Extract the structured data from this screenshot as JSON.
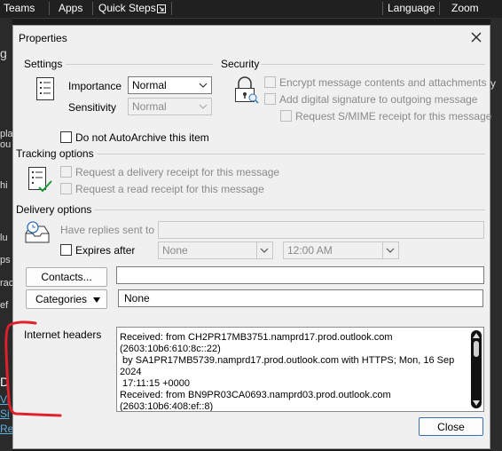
{
  "ribbon": {
    "items": [
      "Teams",
      "Apps",
      "Quick Steps",
      "Language",
      "Zoom"
    ]
  },
  "dialog": {
    "title": "Properties",
    "settings": {
      "group_label": "Settings",
      "importance_label": "Importance",
      "importance_value": "Normal",
      "sensitivity_label": "Sensitivity",
      "sensitivity_value": "Normal",
      "autoarchive_label": "Do not AutoArchive this item"
    },
    "security": {
      "group_label": "Security",
      "encrypt_label": "Encrypt message contents and attachments",
      "signature_label": "Add digital signature to outgoing message",
      "smime_label": "Request S/MIME receipt for this message"
    },
    "tracking": {
      "group_label": "Tracking options",
      "delivery_receipt_label": "Request a delivery receipt for this message",
      "read_receipt_label": "Request a read receipt for this message"
    },
    "delivery": {
      "group_label": "Delivery options",
      "replies_label": "Have replies sent to",
      "replies_value": "",
      "expires_label": "Expires after",
      "expires_date": "None",
      "expires_time": "12:00 AM"
    },
    "contacts_button": "Contacts...",
    "contacts_value": "",
    "categories_button": "Categories",
    "categories_value": "None",
    "headers": {
      "label": "Internet headers",
      "lines": [
        "Received: from CH2PR17MB3751.namprd17.prod.outlook.com",
        "(2603:10b6:610:8c::22)",
        " by SA1PR17MB5739.namprd17.prod.outlook.com with HTTPS; Mon, 16 Sep",
        "2024",
        " 17:11:15 +0000",
        "Received: from BN9PR03CA0693.namprd03.prod.outlook.com",
        "(2603:10b6:408:ef::8)"
      ]
    },
    "close_button": "Close"
  },
  "background_fragments": [
    "g",
    "pla",
    "ou",
    "hi",
    "lu",
    "ps",
    "rac",
    "ef",
    "D",
    "Vi",
    "Si",
    "Re"
  ],
  "annotation": {
    "color": "#e0202a"
  }
}
